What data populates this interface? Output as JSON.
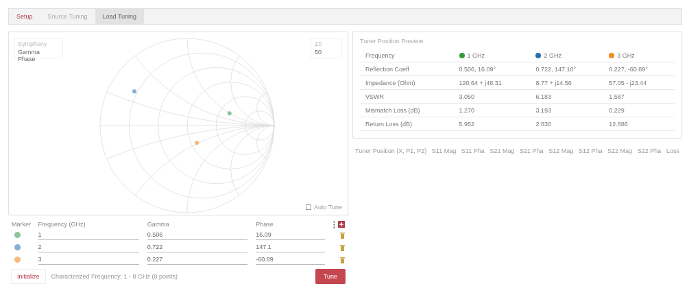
{
  "tabs": [
    {
      "label": "Setup",
      "selected": false,
      "accent": true
    },
    {
      "label": "Source Tuning",
      "selected": false,
      "accent": false
    },
    {
      "label": "Load Tuning",
      "selected": true,
      "accent": false
    }
  ],
  "chart_panel": {
    "mode_field": {
      "label": "Symphony",
      "value": "Gamma Phase"
    },
    "z0_field": {
      "label": "Z0",
      "value": "50"
    },
    "auto_tune": {
      "label": "Auto Tune",
      "checked": false
    }
  },
  "preview": {
    "title": "Tuner Position Preview",
    "header": "Frequency",
    "frequencies": [
      {
        "label": "1 GHz",
        "color": "#2e9e3a"
      },
      {
        "label": "2 GHz",
        "color": "#2a6fb0"
      },
      {
        "label": "3 GHz",
        "color": "#f08a24"
      }
    ],
    "rows": [
      {
        "name": "Reflection Coeff",
        "values": [
          "0.506, 16.09°",
          "0.722, 147.10°",
          "0.227, -60.89°"
        ]
      },
      {
        "name": "Impedance (Ohm)",
        "values": [
          "120.64 + j48.31",
          "8.77 + j14.56",
          "57.05 - j23.44"
        ]
      },
      {
        "name": "VSWR",
        "values": [
          "3.050",
          "6.183",
          "1.587"
        ]
      },
      {
        "name": "Mismatch Loss (dB)",
        "values": [
          "1.270",
          "3.193",
          "0.229"
        ]
      },
      {
        "name": "Return Loss (dB)",
        "values": [
          "5.952",
          "2.830",
          "12.886"
        ]
      }
    ]
  },
  "markers": {
    "columns": [
      "Marker",
      "Frequency (GHz)",
      "Gamma",
      "Phase"
    ],
    "rows": [
      {
        "color": "#8cc79a",
        "frequency": "1",
        "gamma": "0.506",
        "phase": "16.09"
      },
      {
        "color": "#87aed6",
        "frequency": "2",
        "gamma": "0.722",
        "phase": "147.1"
      },
      {
        "color": "#f5b980",
        "frequency": "3",
        "gamma": "0.227",
        "phase": "-60.89"
      }
    ]
  },
  "initialize_button": "Initialize",
  "characterized": "Characterized Frequency: 1 - 8 GHz (8 points)",
  "tune_button": "Tune",
  "positions": {
    "columns": [
      "Tuner Position (X, P1, P2)",
      "S11 Mag",
      "S11 Pha",
      "S21 Mag",
      "S21 Pha",
      "S12 Mag",
      "S12 Pha",
      "S22 Mag",
      "S22 Pha",
      "Loss"
    ]
  }
}
